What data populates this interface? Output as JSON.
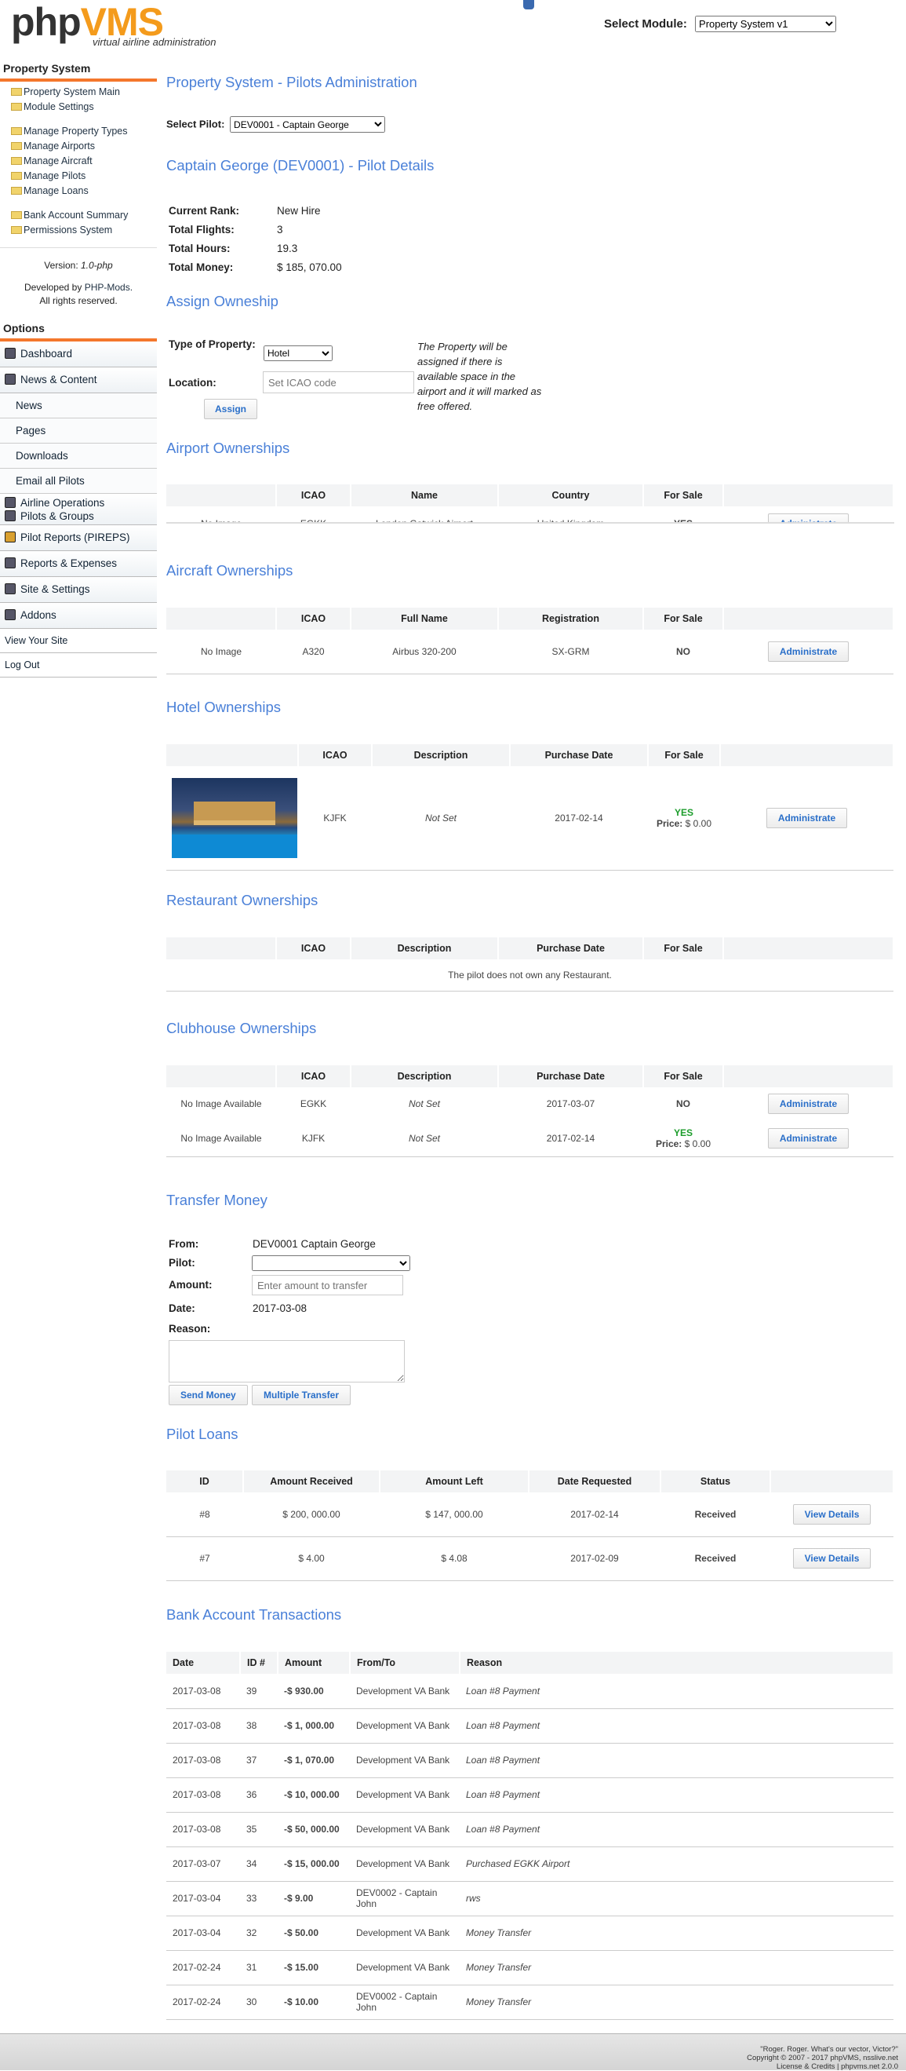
{
  "header": {
    "logo_php": "php",
    "logo_vms": "VMS",
    "logo_tagline": "virtual airline administration",
    "module_label": "Select Module:",
    "module_selected": "Property System v1"
  },
  "sidebar": {
    "section_title": "Property System",
    "group1": [
      "Property System Main",
      "Module Settings"
    ],
    "group2": [
      "Manage Property Types",
      "Manage Airports",
      "Manage Aircraft",
      "Manage Pilots",
      "Manage Loans"
    ],
    "group3": [
      "Bank Account Summary",
      "Permissions System"
    ],
    "version_label": "Version:",
    "version_value": "1.0-php",
    "developed_by": "Developed by",
    "developer": "PHP-Mods.",
    "rights": "All rights reserved.",
    "options_title": "Options",
    "menu": {
      "dashboard": "Dashboard",
      "news_content": "News & Content",
      "news": "News",
      "pages": "Pages",
      "downloads": "Downloads",
      "email_pilots": "Email all Pilots",
      "airline_ops": "Airline Operations",
      "pilots_groups": "Pilots & Groups",
      "pireps": "Pilot Reports (PIREPS)",
      "reports": "Reports & Expenses",
      "site_settings": "Site & Settings",
      "addons": "Addons",
      "view_site": "View Your Site",
      "logout": "Log Out"
    }
  },
  "main": {
    "page_title": "Property System - Pilots Administration",
    "select_pilot_label": "Select Pilot:",
    "select_pilot_value": "DEV0001 - Captain George",
    "details_title": "Captain George (DEV0001) - Pilot Details",
    "details": {
      "rank_label": "Current Rank:",
      "rank_value": "New Hire",
      "flights_label": "Total Flights:",
      "flights_value": "3",
      "hours_label": "Total Hours:",
      "hours_value": "19.3",
      "money_label": "Total Money:",
      "money_value": "$ 185, 070.00"
    },
    "assign": {
      "title": "Assign Owneship",
      "type_label": "Type of Property:",
      "type_value": "Hotel",
      "location_label": "Location:",
      "location_placeholder": "Set ICAO code",
      "note": "The Property will be assigned if there is available space in the airport and it will marked as free offered.",
      "button": "Assign"
    },
    "airport_own": {
      "title": "Airport Ownerships",
      "headers": [
        "",
        "ICAO",
        "Name",
        "Country",
        "For Sale",
        ""
      ],
      "row": {
        "image": "No Image",
        "icao": "EGKK",
        "name": "London Gatwick Airport",
        "country": "United Kingdom",
        "sale": "YES",
        "button": "Administrate"
      }
    },
    "aircraft_own": {
      "title": "Aircraft Ownerships",
      "headers": [
        "",
        "ICAO",
        "Full Name",
        "Registration",
        "For Sale",
        ""
      ],
      "row": {
        "image": "No Image",
        "icao": "A320",
        "name": "Airbus 320-200",
        "reg": "SX-GRM",
        "sale": "NO",
        "button": "Administrate"
      }
    },
    "hotel_own": {
      "title": "Hotel Ownerships",
      "headers": [
        "",
        "ICAO",
        "Description",
        "Purchase Date",
        "For Sale",
        ""
      ],
      "row": {
        "icao": "KJFK",
        "desc": "Not Set",
        "date": "2017-02-14",
        "sale": "YES",
        "price_label": "Price:",
        "price": "$ 0.00",
        "button": "Administrate"
      }
    },
    "restaurant_own": {
      "title": "Restaurant Ownerships",
      "headers": [
        "",
        "ICAO",
        "Description",
        "Purchase Date",
        "For Sale",
        ""
      ],
      "empty": "The pilot does not own any Restaurant."
    },
    "clubhouse_own": {
      "title": "Clubhouse Ownerships",
      "headers": [
        "",
        "ICAO",
        "Description",
        "Purchase Date",
        "For Sale",
        ""
      ],
      "rows": [
        {
          "image": "No Image Available",
          "icao": "EGKK",
          "desc": "Not Set",
          "date": "2017-03-07",
          "sale": "NO",
          "price": "",
          "button": "Administrate"
        },
        {
          "image": "No Image Available",
          "icao": "KJFK",
          "desc": "Not Set",
          "date": "2017-02-14",
          "sale": "YES",
          "price": "$ 0.00",
          "button": "Administrate"
        }
      ],
      "price_label": "Price:"
    },
    "transfer": {
      "title": "Transfer Money",
      "from_label": "From:",
      "from_value": "DEV0001 Captain George",
      "pilot_label": "Pilot:",
      "amount_label": "Amount:",
      "amount_placeholder": "Enter amount to transfer",
      "date_label": "Date:",
      "date_value": "2017-03-08",
      "reason_label": "Reason:",
      "send_button": "Send Money",
      "multiple_button": "Multiple Transfer"
    },
    "loans": {
      "title": "Pilot Loans",
      "headers": [
        "ID",
        "Amount Received",
        "Amount Left",
        "Date Requested",
        "Status",
        ""
      ],
      "rows": [
        {
          "id": "#8",
          "received": "$ 200, 000.00",
          "left": "$ 147, 000.00",
          "date": "2017-02-14",
          "status": "Received",
          "button": "View Details"
        },
        {
          "id": "#7",
          "received": "$ 4.00",
          "left": "$ 4.08",
          "date": "2017-02-09",
          "status": "Received",
          "button": "View Details"
        }
      ]
    },
    "bank": {
      "title": "Bank Account Transactions",
      "headers": [
        "Date",
        "ID #",
        "Amount",
        "From/To",
        "Reason"
      ],
      "rows": [
        {
          "date": "2017-03-08",
          "id": "39",
          "amount": "-$ 930.00",
          "from": "Development VA Bank",
          "reason": "Loan #8 Payment"
        },
        {
          "date": "2017-03-08",
          "id": "38",
          "amount": "-$ 1, 000.00",
          "from": "Development VA Bank",
          "reason": "Loan #8 Payment"
        },
        {
          "date": "2017-03-08",
          "id": "37",
          "amount": "-$ 1, 070.00",
          "from": "Development VA Bank",
          "reason": "Loan #8 Payment"
        },
        {
          "date": "2017-03-08",
          "id": "36",
          "amount": "-$ 10, 000.00",
          "from": "Development VA Bank",
          "reason": "Loan #8 Payment"
        },
        {
          "date": "2017-03-08",
          "id": "35",
          "amount": "-$ 50, 000.00",
          "from": "Development VA Bank",
          "reason": "Loan #8 Payment"
        },
        {
          "date": "2017-03-07",
          "id": "34",
          "amount": "-$ 15, 000.00",
          "from": "Development VA Bank",
          "reason": "Purchased EGKK Airport"
        },
        {
          "date": "2017-03-04",
          "id": "33",
          "amount": "-$ 9.00",
          "from": "DEV0002 - Captain John",
          "reason": "rws"
        },
        {
          "date": "2017-03-04",
          "id": "32",
          "amount": "-$ 50.00",
          "from": "Development VA Bank",
          "reason": "Money Transfer"
        },
        {
          "date": "2017-02-24",
          "id": "31",
          "amount": "-$ 15.00",
          "from": "Development VA Bank",
          "reason": "Money Transfer"
        },
        {
          "date": "2017-02-24",
          "id": "30",
          "amount": "-$ 10.00",
          "from": "DEV0002 - Captain John",
          "reason": "Money Transfer"
        }
      ]
    }
  },
  "footer": {
    "quote": "\"Roger. Roger. What's our vector, Victor?\"",
    "copyright": "Copyright © 2007 - 2017 phpVMS, nsslive.net",
    "license": "License & Credits | phpvms.net 2.0.0"
  }
}
